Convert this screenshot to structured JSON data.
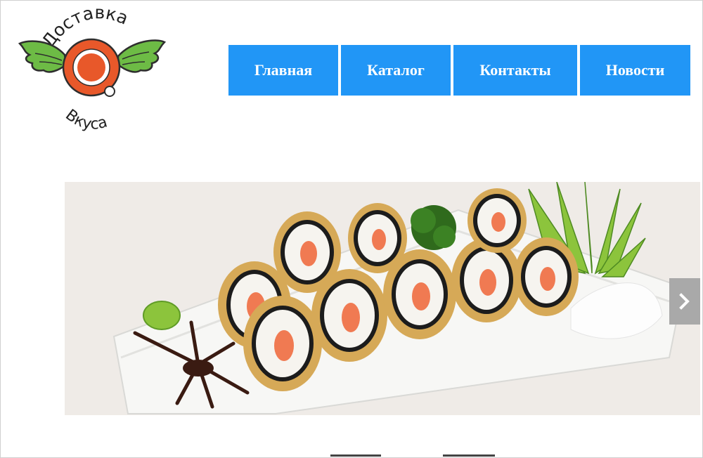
{
  "logo": {
    "top_text": "Доставка",
    "bottom_text": "Вкуса",
    "icon": "plate-with-wings-logo"
  },
  "nav": {
    "items": [
      {
        "label": "Главная"
      },
      {
        "label": "Каталог"
      },
      {
        "label": "Контакты"
      },
      {
        "label": "Новости"
      }
    ]
  },
  "slider": {
    "image": "sushi-rolls-photo",
    "next_icon": "chevron-right-icon",
    "indicator_count": 2
  },
  "colors": {
    "nav_bg": "#2196f6",
    "nav_text": "#ffffff",
    "logo_orange": "#e8582a",
    "logo_green": "#6dbb45",
    "next_btn_bg": "#a9a9a9"
  }
}
